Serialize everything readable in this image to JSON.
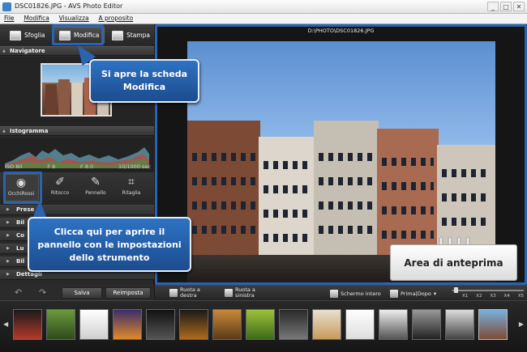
{
  "window": {
    "title": "DSC01826.JPG - AVS Photo Editor",
    "minimize": "_",
    "maximize": "□",
    "close": "✕"
  },
  "menu": [
    "File",
    "Modifica",
    "Visualizza",
    "A proposito"
  ],
  "tabs": [
    {
      "label": "Sfoglia",
      "icon": "browse-icon"
    },
    {
      "label": "Modifica",
      "icon": "edit-icon",
      "active": true
    },
    {
      "label": "Stampa",
      "icon": "print-icon"
    }
  ],
  "panel": {
    "navigator": "Navigatore",
    "histogram": "Istogramma",
    "hist_stats": {
      "iso": "ISO 80",
      "f1": "F 8",
      "f2": "F 8.0",
      "shutter": "10/1000 sec"
    },
    "tools": [
      {
        "label": "OcchiRossi",
        "icon": "eye-icon",
        "glyph": "◉"
      },
      {
        "label": "Ritocco",
        "icon": "retouch-icon",
        "glyph": "✐"
      },
      {
        "label": "Pennello",
        "icon": "brush-icon",
        "glyph": "✎"
      },
      {
        "label": "Ritaglia",
        "icon": "crop-icon",
        "glyph": "⌗"
      }
    ],
    "sections": [
      "Prese",
      "Bil",
      "Co",
      "Lu",
      "Bil"
    ],
    "details": "Dettagli",
    "save": "Salva",
    "reset": "Reimposta"
  },
  "preview": {
    "path": "D:\\PHOTO\\DSC01826.JPG",
    "toolbar": {
      "rotate_right": "Ruota a destra",
      "rotate_left": "Ruota a sinistra",
      "fullscreen": "Schermo intero",
      "before_after": "Prima|Dopo",
      "zoom_labels": [
        "X1",
        "X2",
        "X3",
        "X4",
        "X5"
      ]
    }
  },
  "callouts": {
    "modifica": "Si apre la scheda Modifica",
    "tool": "Clicca qui per aprire il pannello con le impostazioni dello strumento",
    "preview": "Area di anteprima"
  },
  "colors": {
    "accent": "#2a63b0",
    "panel": "#2a2a2a",
    "toolbar": "#3c3c3c"
  }
}
